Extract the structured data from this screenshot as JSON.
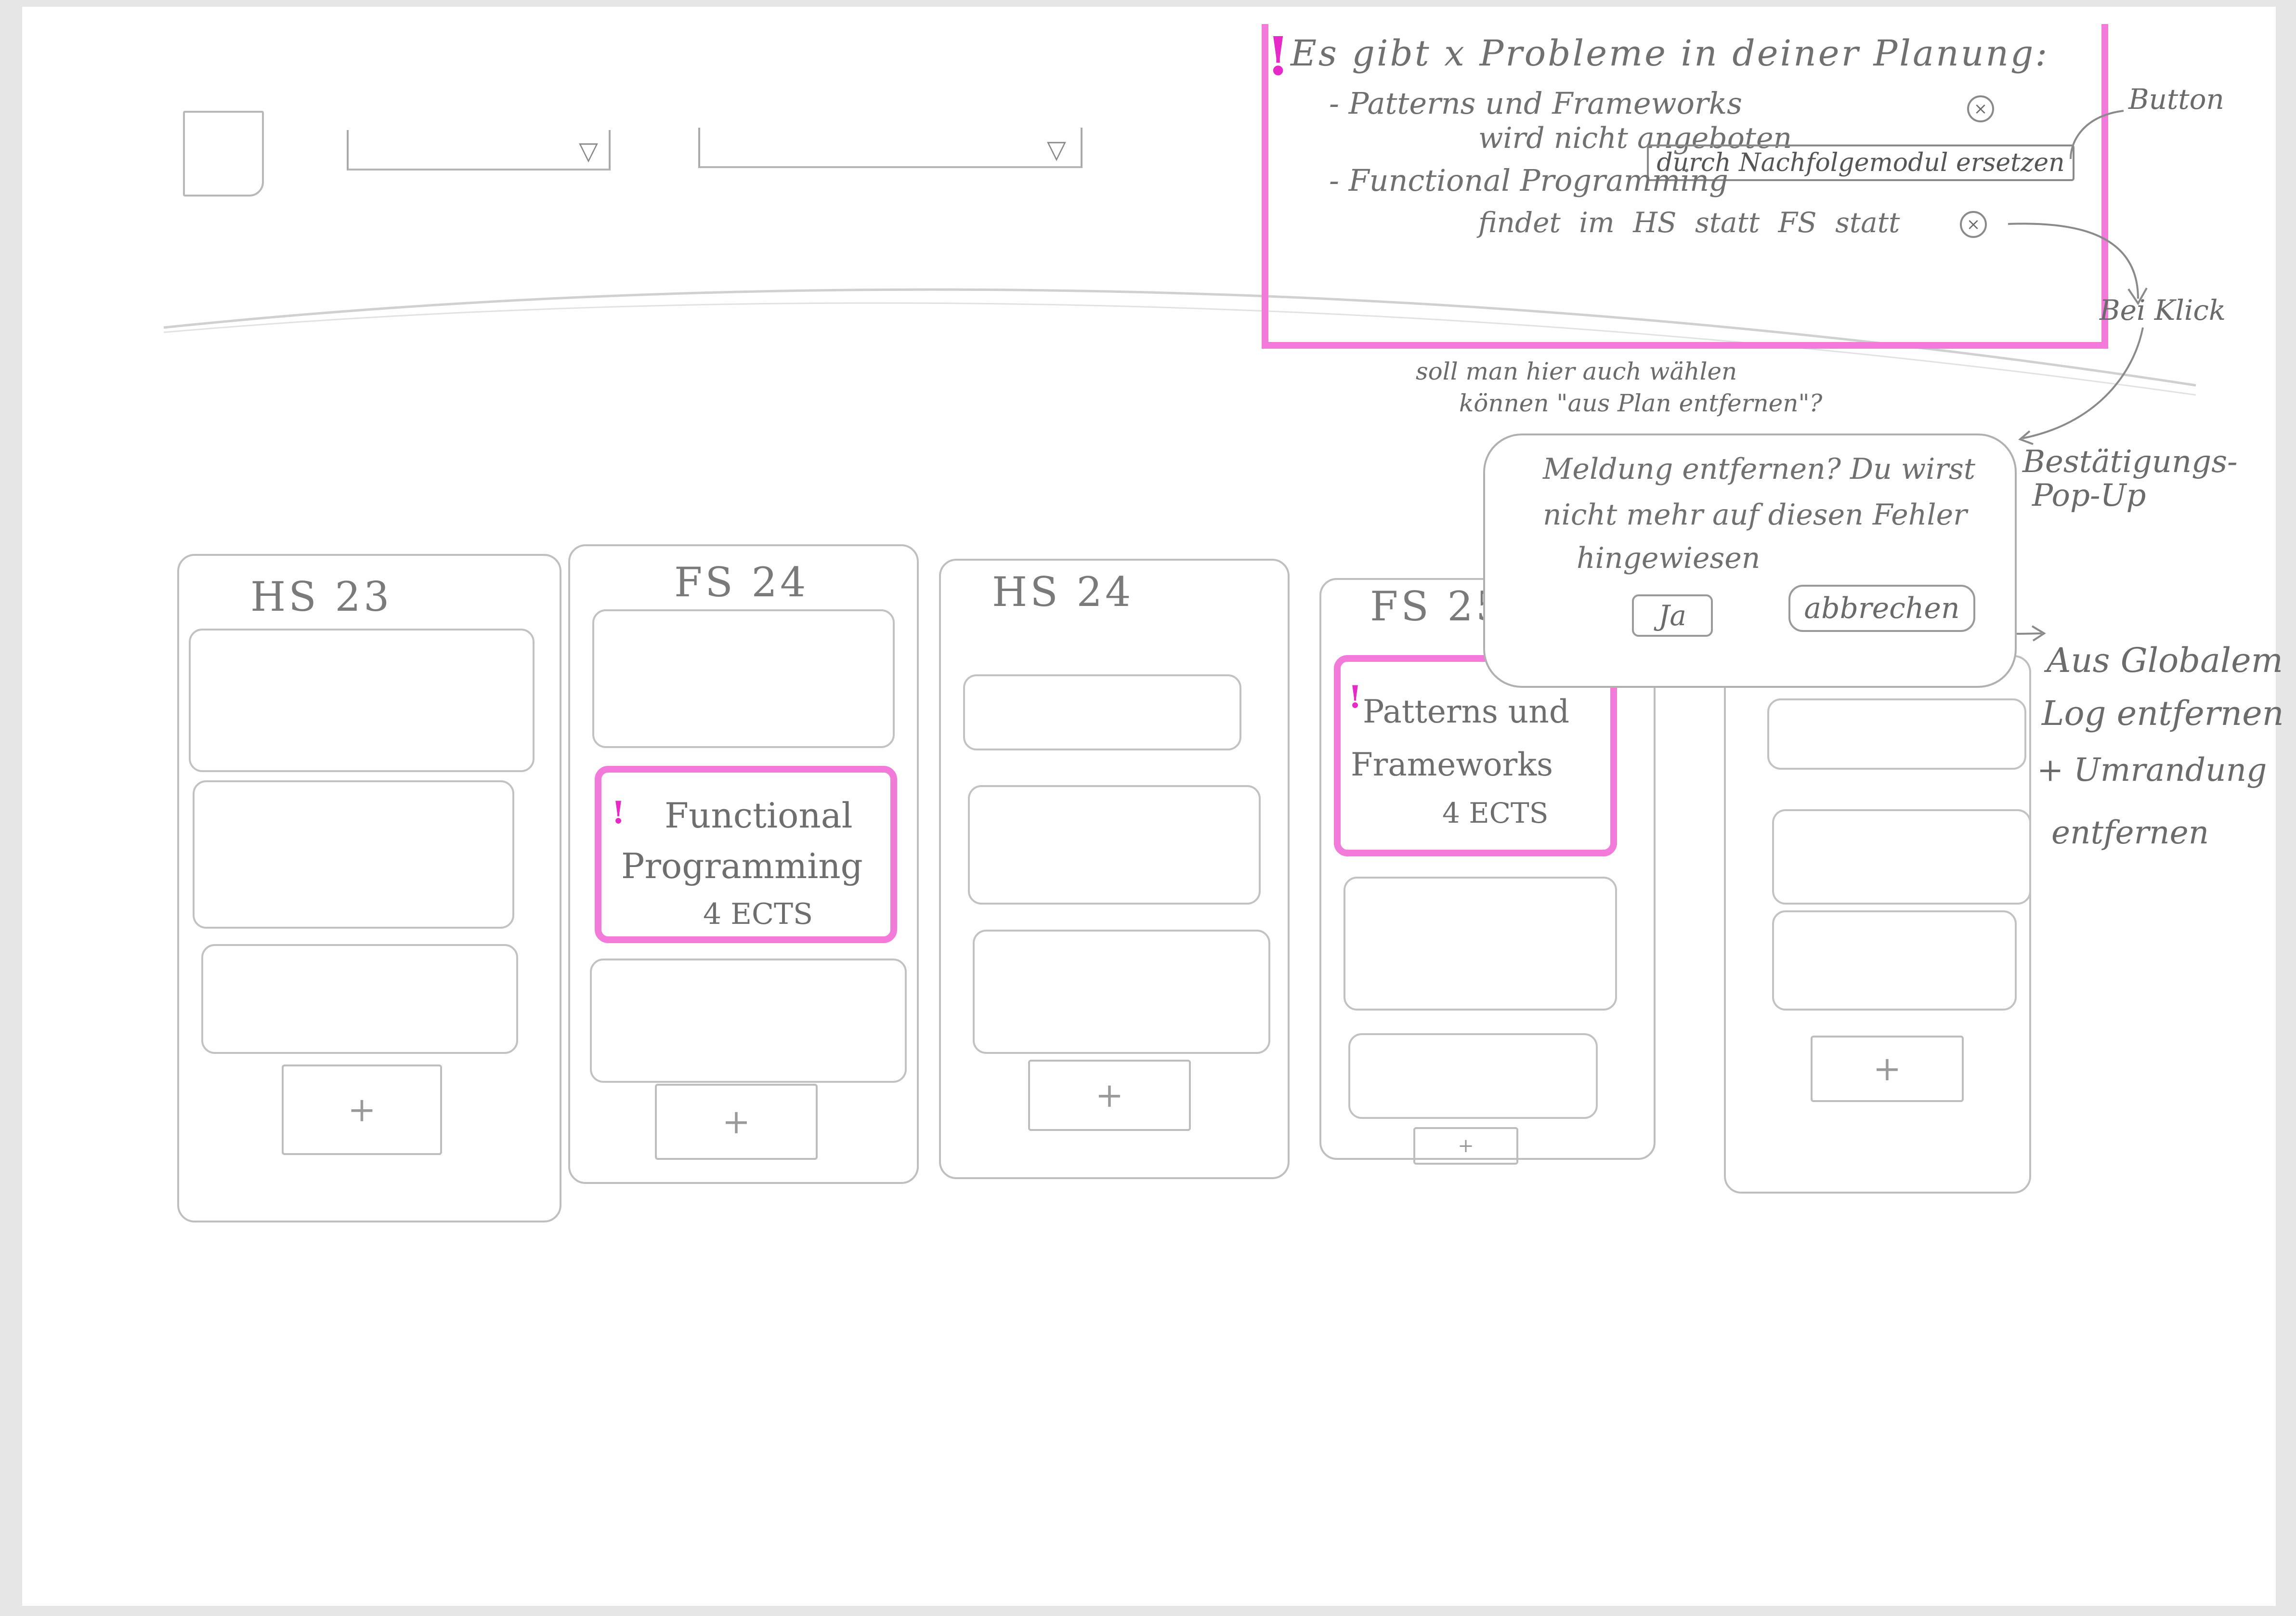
{
  "problems": {
    "heading": "Es gibt x Probleme in deiner Planung:",
    "item1_line1": "- Patterns und Frameworks",
    "item1_line2": "wird nicht angeboten",
    "item1_button": "durch Nachfolgemodul ersetzen",
    "item2_line1": "- Functional Programming",
    "item2_line2": "findet im HS statt FS statt"
  },
  "annotations": {
    "button": "Button",
    "bei_klick": "Bei Klick",
    "question_line1": "soll man hier auch wählen",
    "question_line2": "können \"aus Plan entfernen\"?",
    "popup_label_line1": "Bestätigungs-",
    "popup_label_line2": "Pop-Up",
    "after_line1": "Aus Globalem",
    "after_line2": "Log entfernen",
    "after_line3": "+ Umrandung",
    "after_line4": "entfernen"
  },
  "popup": {
    "message_line1": "Meldung entfernen? Du wirst",
    "message_line2": "nicht mehr auf diesen Fehler",
    "message_line3": "hingewiesen",
    "confirm": "Ja",
    "cancel": "abbrechen"
  },
  "semesters": [
    {
      "title": "HS 23"
    },
    {
      "title": "FS 24",
      "flagged_card": {
        "line1": "Functional",
        "line2": "Programming",
        "line3": "4 ECTS"
      }
    },
    {
      "title": "HS 24"
    },
    {
      "title": "FS 25",
      "flagged_card": {
        "line1": "Patterns und",
        "line2": "Frameworks",
        "line3": "4 ECTS"
      }
    },
    {
      "title": ""
    }
  ],
  "add_label": "+",
  "icons": {
    "close": "×",
    "warning": "!",
    "dropdown": "▽"
  },
  "colors": {
    "highlight": "#f27ad9",
    "pencil": "#8a8a8a"
  }
}
